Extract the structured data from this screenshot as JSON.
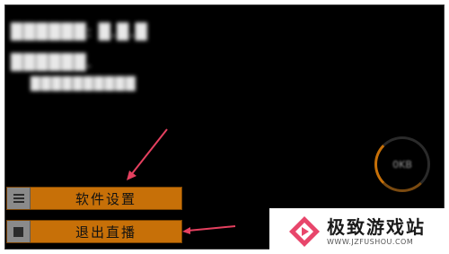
{
  "blurred_info": {
    "line1": "██████: █.█.█",
    "line2": "██████.",
    "line3": "██████████"
  },
  "menu": {
    "settings_label": "软件设置",
    "exit_label": "退出直播"
  },
  "gauge": {
    "text": "0KB"
  },
  "watermark": {
    "title": "极致游戏站",
    "url": "WWW.JZFUSHOU.COM"
  },
  "colors": {
    "accent": "#c77008",
    "screen_bg": "#000000",
    "arrow": "#e4405f"
  },
  "icons": {
    "settings": "menu-lines-icon",
    "exit": "stop-square-icon",
    "logo": "pink-diamond-play-icon"
  }
}
